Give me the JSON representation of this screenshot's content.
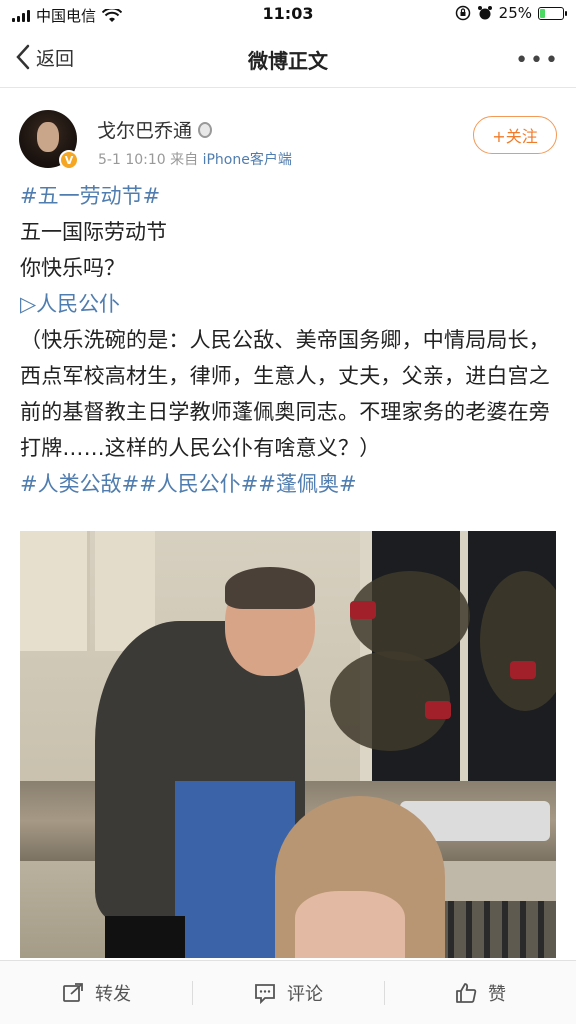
{
  "status_bar": {
    "carrier": "中国电信",
    "time": "11:03",
    "battery": "25%",
    "battery_level": 0.25
  },
  "nav": {
    "back_label": "返回",
    "title": "微博正文",
    "more_icon": "more-dots-icon"
  },
  "author": {
    "name": "戈尔巴乔通",
    "time": "5-1 10:10",
    "source_prefix": "来自",
    "source": "iPhone客户端",
    "follow_label": "+关注",
    "verified_badge": "V"
  },
  "post": {
    "hashtag_top": "#五一劳动节#",
    "line1": "五一国际劳动节",
    "line2": "你快乐吗？",
    "link": "▷人民公仆",
    "paragraph": "（快乐洗碗的是：人民公敌、美帝国务卿，中情局局长，西点军校高材生，律师，生意人，丈夫，父亲，进白宫之前的基督教主日学教师蓬佩奥同志。不理家务的老婆在旁打牌……这样的人民公仆有啥意义？）",
    "hashtags_bottom": "#人类公敌##人民公仆##蓬佩奥#"
  },
  "actions": [
    {
      "label": "转发",
      "icon": "share-icon"
    },
    {
      "label": "评论",
      "icon": "comment-icon"
    },
    {
      "label": "赞",
      "icon": "like-icon"
    }
  ],
  "colors": {
    "link": "#507daf",
    "follow": "#f07b2a",
    "battery": "#4cd964"
  }
}
